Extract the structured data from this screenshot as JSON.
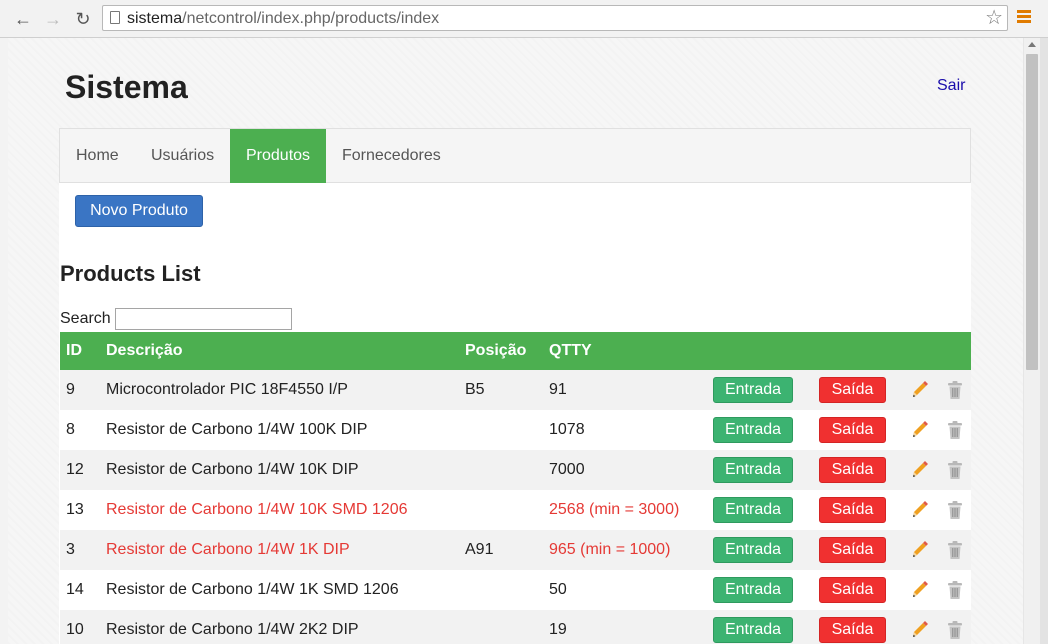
{
  "browser": {
    "url_host": "sistema",
    "url_path": "/netcontrol/index.php/products/index"
  },
  "header": {
    "title": "Sistema",
    "logout_label": "Sair"
  },
  "nav": {
    "items": [
      {
        "label": "Home"
      },
      {
        "label": "Usuários"
      },
      {
        "label": "Produtos"
      },
      {
        "label": "Fornecedores"
      }
    ],
    "active": "Produtos"
  },
  "main": {
    "new_product_label": "Novo Produto",
    "list_title": "Products List",
    "search_label": "Search",
    "search_value": ""
  },
  "table": {
    "columns": [
      "ID",
      "Descrição",
      "Posição",
      "QTTY"
    ],
    "entrada_label": "Entrada",
    "saida_label": "Saída",
    "rows": [
      {
        "id": "9",
        "desc": "Microcontrolador PIC 18F4550 I/P",
        "pos": "B5",
        "qty": "91"
      },
      {
        "id": "8",
        "desc": "Resistor de Carbono 1/4W 100K DIP",
        "pos": "",
        "qty": "1078"
      },
      {
        "id": "12",
        "desc": "Resistor de Carbono 1/4W 10K DIP",
        "pos": "",
        "qty": "7000"
      },
      {
        "id": "13",
        "desc": "Resistor de Carbono 1/4W 10K SMD 1206",
        "pos": "",
        "qty": "2568 (min = 3000)"
      },
      {
        "id": "3",
        "desc": "Resistor de Carbono 1/4W 1K DIP",
        "pos": "A91",
        "qty": "965 (min = 1000)"
      },
      {
        "id": "14",
        "desc": "Resistor de Carbono 1/4W 1K SMD 1206",
        "pos": "",
        "qty": "50"
      },
      {
        "id": "10",
        "desc": "Resistor de Carbono 1/4W 2K2 DIP",
        "pos": "",
        "qty": "19"
      }
    ]
  },
  "colors": {
    "accent_green": "#4caf50",
    "entrada_green": "#3cb371",
    "saida_red": "#f03030",
    "low_stock_red": "#e53935",
    "primary_blue": "#3a75c4",
    "link_blue": "#1a0dab"
  },
  "icons": {
    "edit": "pencil-icon",
    "delete": "trash-icon"
  }
}
